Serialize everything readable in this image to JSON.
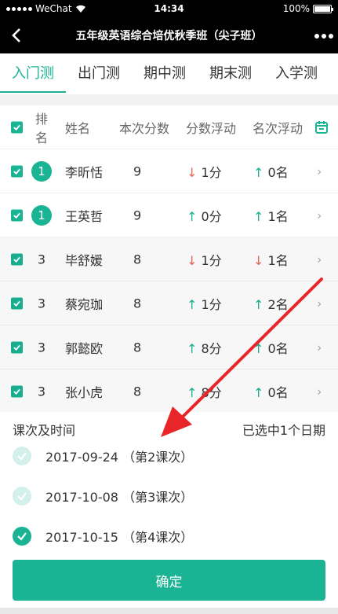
{
  "status": {
    "carrier": "WeChat",
    "time": "14:34",
    "battery": "100%"
  },
  "nav": {
    "title": "五年级英语综合培优秋季班（尖子班）"
  },
  "tabs": [
    {
      "label": "入门测",
      "active": true
    },
    {
      "label": "出门测"
    },
    {
      "label": "期中测"
    },
    {
      "label": "期末测"
    },
    {
      "label": "入学测"
    }
  ],
  "table": {
    "headers": {
      "rank": "排名",
      "name": "姓名",
      "score": "本次分数",
      "change": "分数浮动",
      "rank_change": "名次浮动"
    },
    "rows": [
      {
        "rank": "1",
        "badge": true,
        "name": "李昕恬",
        "score": "9",
        "change_dir": "down",
        "change": "1分",
        "rank_dir": "up",
        "rank_change": "0名"
      },
      {
        "rank": "1",
        "badge": true,
        "name": "王英哲",
        "score": "9",
        "change_dir": "up",
        "change": "0分",
        "rank_dir": "up",
        "rank_change": "1名"
      },
      {
        "rank": "3",
        "badge": false,
        "name": "毕舒媛",
        "score": "8",
        "change_dir": "down",
        "change": "1分",
        "rank_dir": "down",
        "rank_change": "1名"
      },
      {
        "rank": "3",
        "badge": false,
        "name": "蔡宛珈",
        "score": "8",
        "change_dir": "up",
        "change": "1分",
        "rank_dir": "up",
        "rank_change": "2名"
      },
      {
        "rank": "3",
        "badge": false,
        "name": "郭懿欧",
        "score": "8",
        "change_dir": "up",
        "change": "8分",
        "rank_dir": "up",
        "rank_change": "0名"
      },
      {
        "rank": "3",
        "badge": false,
        "name": "张小虎",
        "score": "8",
        "change_dir": "up",
        "change": "8分",
        "rank_dir": "up",
        "rank_change": "0名"
      }
    ]
  },
  "panel": {
    "title": "课次及时间",
    "selected_info": "已选中1个日期",
    "options": [
      {
        "label": "2017-09-24 （第2课次）",
        "checked": false
      },
      {
        "label": "2017-10-08 （第3课次）",
        "checked": false
      },
      {
        "label": "2017-10-15 （第4课次）",
        "checked": true
      }
    ],
    "confirm_label": "确定"
  },
  "colors": {
    "accent": "#1ab394",
    "down": "#e86a5d",
    "annotation": "#e8262a"
  },
  "icons": {
    "back": "chevron-left-icon",
    "more": "more-dots-icon",
    "calendar": "calendar-icon",
    "row_arrow": "chevron-right-icon"
  }
}
